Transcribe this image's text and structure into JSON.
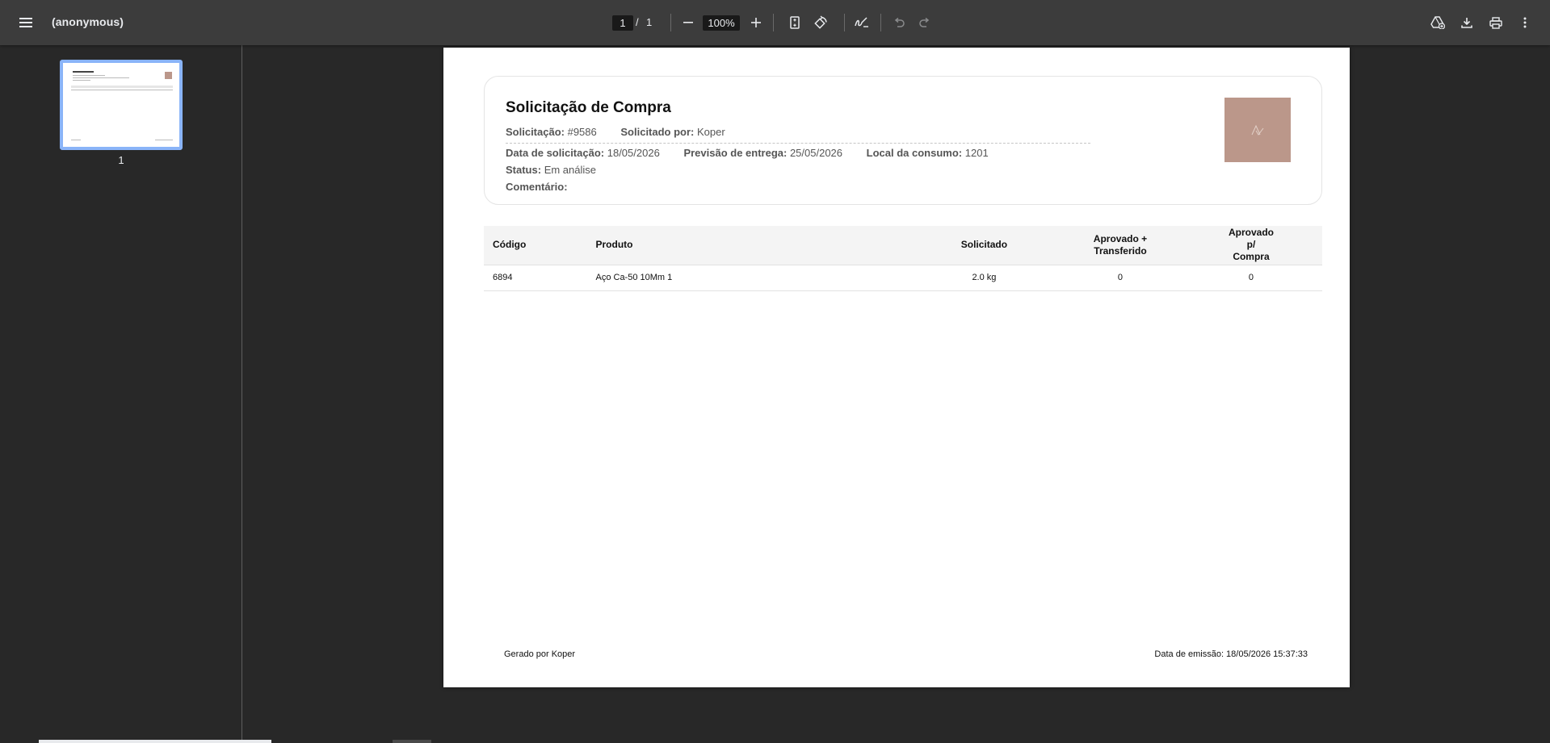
{
  "toolbar": {
    "title": "(anonymous)",
    "current_page": "1",
    "page_separator": "/",
    "total_pages": "1",
    "zoom": "100%"
  },
  "sidebar": {
    "thumbnail_label": "1"
  },
  "document": {
    "title": "Solicitação de Compra",
    "fields_row1": [
      {
        "label": "Solicitação:",
        "value": "#9586"
      },
      {
        "label": "Solicitado por:",
        "value": "Koper"
      }
    ],
    "fields_row2": [
      {
        "label": "Data de solicitação:",
        "value": "18/05/2026"
      },
      {
        "label": "Previsão de entrega:",
        "value": "25/05/2026"
      },
      {
        "label": "Local da consumo:",
        "value": "1201"
      }
    ],
    "status": {
      "label": "Status:",
      "value": "Em análise"
    },
    "comment": {
      "label": "Comentário:",
      "value": ""
    },
    "table": {
      "headers": [
        "Código",
        "Produto",
        "Solicitado",
        "Aprovado + Transferido",
        "Aprovado p/ Compra"
      ],
      "rows": [
        [
          "6894",
          "Aço Ca-50 10Mm 1",
          "2.0 kg",
          "0",
          "0"
        ]
      ]
    },
    "footer_left": "Gerado por Koper",
    "footer_right": "Data de emissão: 18/05/2026 15:37:33"
  },
  "colors": {
    "toolbar_bg": "#3c3c3c",
    "viewer_bg": "#282828",
    "thumbnail_border": "#8ab4f8",
    "logo_bg": "#bb978a"
  },
  "icons": {
    "menu": "hamburger-menu-icon",
    "zoom_out": "minus-icon",
    "zoom_in": "plus-icon",
    "fit": "fit-page-icon",
    "rotate": "rotate-icon",
    "annotate": "draw-icon",
    "undo": "undo-icon",
    "redo": "redo-icon",
    "drive": "save-to-drive-icon",
    "download": "download-icon",
    "print": "print-icon",
    "more": "more-vert-icon"
  }
}
